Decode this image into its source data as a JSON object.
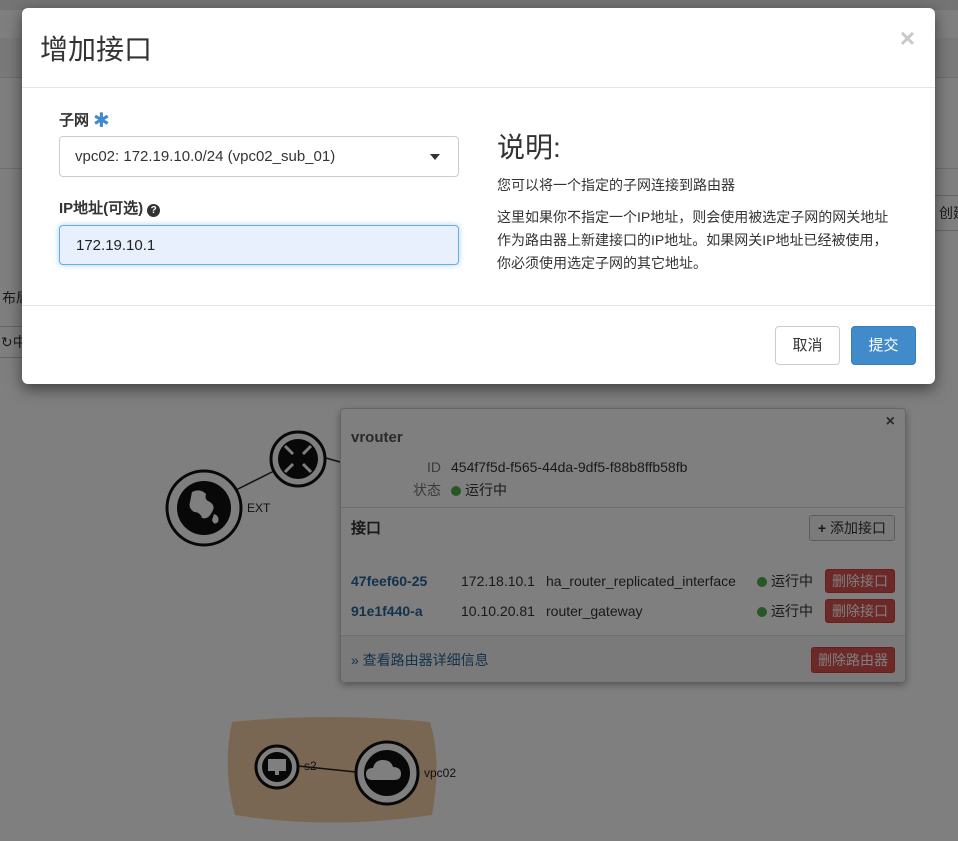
{
  "background": {
    "create_fragment": "创建",
    "left_fragment": "布局",
    "refresh_fragment": "中"
  },
  "topology": {
    "ext_label": "EXT",
    "s2_label": "s2",
    "vpc_label": "vpc02"
  },
  "router_panel": {
    "title": "vrouter",
    "id_label": "ID",
    "id_value": "454f7f5d-f565-44da-9df5-f88b8ffb58fb",
    "status_label": "状态",
    "status_value": "运行中",
    "interfaces_title": "接口",
    "add_interface_label": "添加接口",
    "interfaces": [
      {
        "id": "47feef60-25",
        "ip": "172.18.10.1",
        "name": "ha_router_replicated_interface",
        "status": "运行中",
        "delete_label": "删除接口"
      },
      {
        "id": "91e1f440-a",
        "ip": "10.10.20.81",
        "name": "router_gateway",
        "status": "运行中",
        "delete_label": "删除接口"
      }
    ],
    "detail_link": "» 查看路由器详细信息",
    "delete_router_label": "删除路由器"
  },
  "modal": {
    "title": "增加接口",
    "close_symbol": "×",
    "subnet_label": "子网",
    "required_mark": "✱",
    "subnet_selected": "vpc02: 172.19.10.0/24 (vpc02_sub_01)",
    "ip_label": "IP地址(可选)",
    "help_mark": "?",
    "ip_value": "172.19.10.1",
    "help_title": "说明:",
    "help_line1": "您可以将一个指定的子网连接到路由器",
    "help_line2": "这里如果你不指定一个IP地址，则会使用被选定子网的网关地址作为路由器上新建接口的IP地址。如果网关IP地址已经被使用，你必须使用选定子网的其它地址。",
    "cancel_label": "取消",
    "submit_label": "提交"
  },
  "colors": {
    "primary": "#428bca",
    "danger": "#d9534f",
    "success": "#4cae4c",
    "overlay": "rgba(0,0,0,0.5)"
  }
}
